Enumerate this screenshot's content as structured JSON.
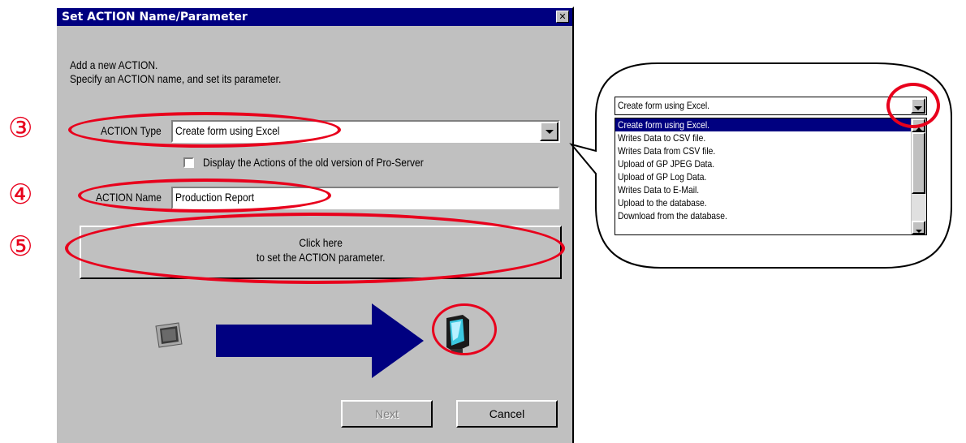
{
  "dialog": {
    "title": "Set ACTION Name/Parameter",
    "close_glyph": "✕",
    "intro_line1": "Add a new ACTION.",
    "intro_line2": "Specify an ACTION name, and set its parameter.",
    "action_type_label": "ACTION Type",
    "action_type_value": "Create form using Excel",
    "old_version_checkbox_label": "Display the Actions of the old version of Pro-Server",
    "old_version_checked": false,
    "action_name_label": "ACTION Name",
    "action_name_value": "Production Report",
    "parameter_button_line1": "Click here",
    "parameter_button_line2": "to set the ACTION parameter.",
    "next_label": "Next",
    "cancel_label": "Cancel"
  },
  "step_markers": [
    "③",
    "④",
    "⑤"
  ],
  "callout": {
    "selected_value": "Create form using Excel.",
    "options": [
      "Create form using Excel.",
      "Writes Data to CSV file.",
      "Writes Data from CSV file.",
      "Upload of GP JPEG Data.",
      "Upload of GP Log Data.",
      "Writes Data to E-Mail.",
      "Upload to the database.",
      "Download from the database."
    ]
  },
  "colors": {
    "title_bar": "#000080",
    "dialog_face": "#c0c0c0",
    "highlight_red": "#e8001c",
    "arrow_blue": "#000080"
  }
}
